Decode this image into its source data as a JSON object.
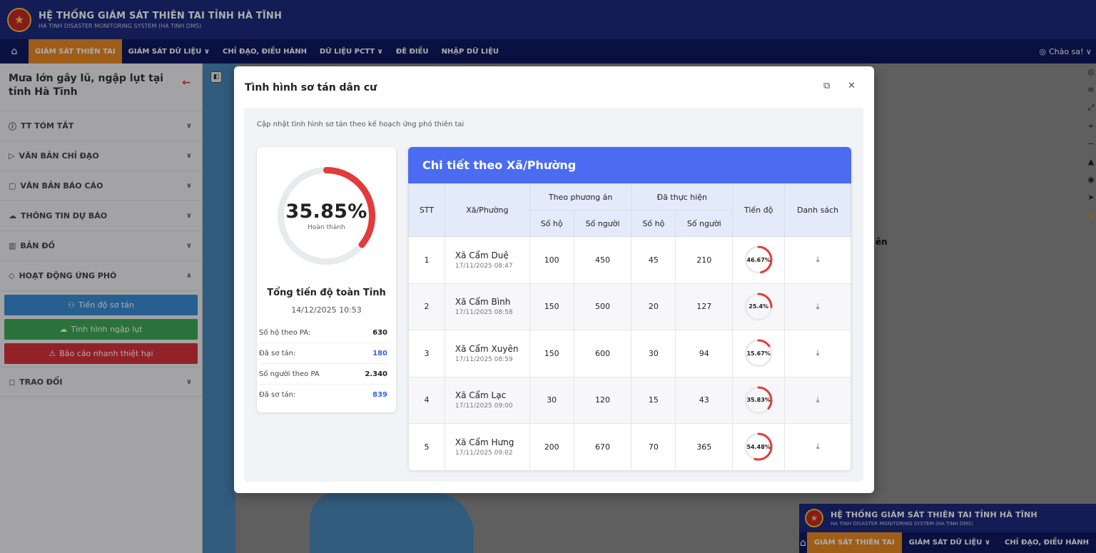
{
  "app": {
    "title": "HỆ THỐNG GIÁM SÁT THIÊN TAI TỈNH HÀ TĨNH",
    "subtitle": "HA TINH DISASTER MONITORING SYSTEM (HA TINH DMS)"
  },
  "nav": {
    "items": [
      {
        "label": "GIÁM SÁT THIÊN TAI",
        "active": true
      },
      {
        "label": "GIÁM SÁT DỮ LIỆU ∨",
        "active": false
      },
      {
        "label": "CHỈ ĐẠO, ĐIỀU HÀNH",
        "active": false
      },
      {
        "label": "DỮ LIỆU PCTT ∨",
        "active": false
      },
      {
        "label": "ĐÊ ĐIỀU",
        "active": false
      },
      {
        "label": "NHẬP DỮ LIỆU",
        "active": false
      }
    ],
    "greeting": "Chào sa! ∨"
  },
  "sidebar": {
    "event_title": "Mưa lớn gây lũ, ngập lụt tại tỉnh Hà Tĩnh",
    "menu": [
      {
        "label": "TT TÓM TẮT",
        "icon": "info-icon"
      },
      {
        "label": "VĂN BẢN CHỈ ĐẠO",
        "icon": "document-send-icon"
      },
      {
        "label": "VĂN BẢN BÁO CÁO",
        "icon": "document-icon"
      },
      {
        "label": "THÔNG TIN DỰ BÁO",
        "icon": "cloud-icon"
      },
      {
        "label": "BẢN ĐỒ",
        "icon": "map-icon"
      },
      {
        "label": "HOẠT ĐỘNG ỨNG PHÓ",
        "icon": "response-icon"
      }
    ],
    "sub_buttons": [
      {
        "label": "Tiến độ sơ tán"
      },
      {
        "label": "Tình hình ngập lụt"
      },
      {
        "label": "Báo cáo nhanh thiệt hại"
      }
    ],
    "exchange": "TRAO ĐỔI"
  },
  "map": {
    "label": "ên"
  },
  "modal": {
    "title": "Tình hình sơ tán dân cư",
    "description": "Cập nhật tình hình sơ tán theo kế hoạch ứng phó thiên tai",
    "summary": {
      "percent": 35.85,
      "percent_text": "35.85%",
      "ring_label": "Hoàn thành",
      "title": "Tổng tiến độ toàn Tỉnh",
      "date": "14/12/2025 10:53",
      "rows": [
        {
          "label": "Số hộ theo PA:",
          "value": "630"
        },
        {
          "label": "Đã sơ tán:",
          "value": "180"
        },
        {
          "label": "Số người theo PA",
          "value": "2.340"
        },
        {
          "label": "Đã sơ tán:",
          "value": "839"
        }
      ]
    },
    "detail": {
      "heading": "Chi tiết theo Xã/Phường",
      "headers": {
        "stt": "STT",
        "xa": "Xã/Phường",
        "plan": "Theo phương án",
        "done": "Đã thực hiện",
        "households": "Số hộ",
        "people": "Số người",
        "progress": "Tiến độ",
        "list": "Danh sách"
      },
      "rows": [
        {
          "stt": "1",
          "name": "Xã Cẩm Duệ",
          "date": "17/11/2025 08:47",
          "plan_hh": "100",
          "plan_ppl": "450",
          "done_hh": "45",
          "done_ppl": "210",
          "progress": 46.67,
          "progress_text": "46.67%"
        },
        {
          "stt": "2",
          "name": "Xã Cẩm Bình",
          "date": "17/11/2025 08:58",
          "plan_hh": "150",
          "plan_ppl": "500",
          "done_hh": "20",
          "done_ppl": "127",
          "progress": 25.4,
          "progress_text": "25.4%"
        },
        {
          "stt": "3",
          "name": "Xã Cẩm Xuyên",
          "date": "17/11/2025 08:59",
          "plan_hh": "150",
          "plan_ppl": "600",
          "done_hh": "30",
          "done_ppl": "94",
          "progress": 15.67,
          "progress_text": "15.67%"
        },
        {
          "stt": "4",
          "name": "Xã Cẩm Lạc",
          "date": "17/11/2025 09:00",
          "plan_hh": "30",
          "plan_ppl": "120",
          "done_hh": "15",
          "done_ppl": "43",
          "progress": 35.83,
          "progress_text": "35.83%"
        },
        {
          "stt": "5",
          "name": "Xã Cẩm Hưng",
          "date": "17/11/2025 09:02",
          "plan_hh": "200",
          "plan_ppl": "670",
          "done_hh": "70",
          "done_ppl": "365",
          "progress": 54.48,
          "progress_text": "54.48%"
        }
      ]
    }
  },
  "mini": {
    "nav": [
      "GIÁM SÁT THIÊN TAI",
      "GIÁM SÁT DỮ LIỆU ∨",
      "CHỈ ĐẠO, ĐIỀU HÀNH"
    ]
  },
  "colors": {
    "header": "#1c2a7c",
    "accent": "#e98b24",
    "progress": "#e23b3b",
    "table_header": "#4b6cf0"
  }
}
